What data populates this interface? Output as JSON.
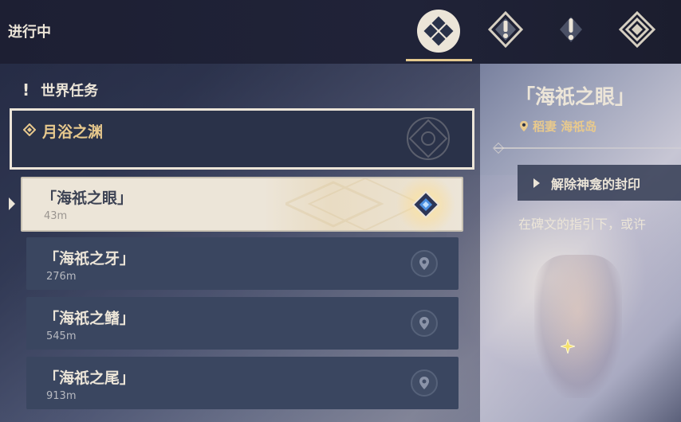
{
  "header": {
    "title": "进行中",
    "tabs": [
      {
        "icon": "all-quests-icon",
        "active": true
      },
      {
        "icon": "archon-quest-icon",
        "active": false
      },
      {
        "icon": "world-quest-icon",
        "active": false
      },
      {
        "icon": "story-quest-icon",
        "active": false
      }
    ]
  },
  "category": {
    "icon": "exclamation-icon",
    "label": "世界任务"
  },
  "quest_group": {
    "icon": "diamond-icon",
    "title": "月浴之渊"
  },
  "sub_quests": [
    {
      "title": "「海祇之眼」",
      "distance": "43m",
      "selected": true
    },
    {
      "title": "「海祇之牙」",
      "distance": "276m",
      "selected": false
    },
    {
      "title": "「海祇之鳍」",
      "distance": "545m",
      "selected": false
    },
    {
      "title": "「海祇之尾」",
      "distance": "913m",
      "selected": false
    }
  ],
  "detail": {
    "title": "「海祇之眼」",
    "location": "稻妻 海祇岛",
    "objective": "解除神龛的封印",
    "description": "在碑文的指引下，或许"
  },
  "colors": {
    "accent_gold": "#e8c98d",
    "cream": "#ece5d8",
    "item_bg": "#3a4660",
    "quest_marker_blue": "#4a8fe0"
  }
}
